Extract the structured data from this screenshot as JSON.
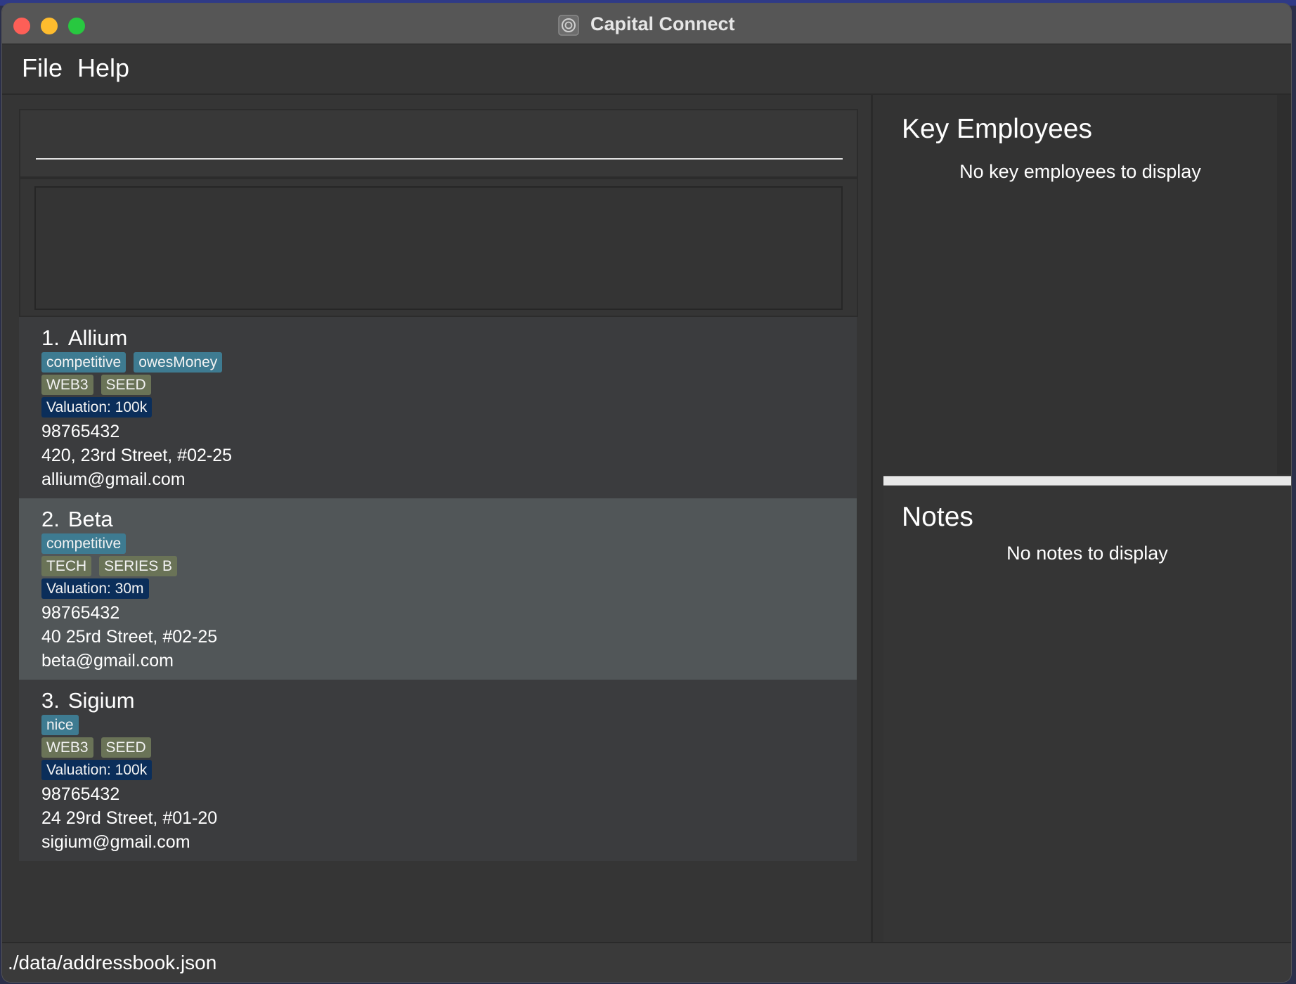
{
  "window": {
    "title": "Capital Connect"
  },
  "menu": {
    "file": "File",
    "help": "Help"
  },
  "command": {
    "value": "",
    "placeholder": ""
  },
  "result": {
    "text": ""
  },
  "companies": [
    {
      "index": "1.",
      "name": "Allium",
      "tags": [
        "competitive",
        "owesMoney"
      ],
      "industry_tags": [
        "WEB3",
        "SEED"
      ],
      "valuation": "Valuation: 100k",
      "phone": "98765432",
      "address": "420, 23rd Street, #02-25",
      "email": "allium@gmail.com"
    },
    {
      "index": "2.",
      "name": "Beta",
      "tags": [
        "competitive"
      ],
      "industry_tags": [
        "TECH",
        "SERIES B"
      ],
      "valuation": "Valuation: 30m",
      "phone": "98765432",
      "address": "40 25rd Street, #02-25",
      "email": "beta@gmail.com"
    },
    {
      "index": "3.",
      "name": "Sigium",
      "tags": [
        "nice"
      ],
      "industry_tags": [
        "WEB3",
        "SEED"
      ],
      "valuation": "Valuation: 100k",
      "phone": "98765432",
      "address": "24 29rd Street, #01-20",
      "email": "sigium@gmail.com"
    }
  ],
  "key_employees": {
    "title": "Key Employees",
    "empty_message": "No key employees to display"
  },
  "notes": {
    "title": "Notes",
    "empty_message": "No notes to display"
  },
  "status": {
    "path": "./data/addressbook.json"
  },
  "colors": {
    "tag_blue": "#3e7b91",
    "tag_olive": "#6a7357",
    "tag_navy": "#0b2e5a",
    "selected_row": "#515658"
  }
}
